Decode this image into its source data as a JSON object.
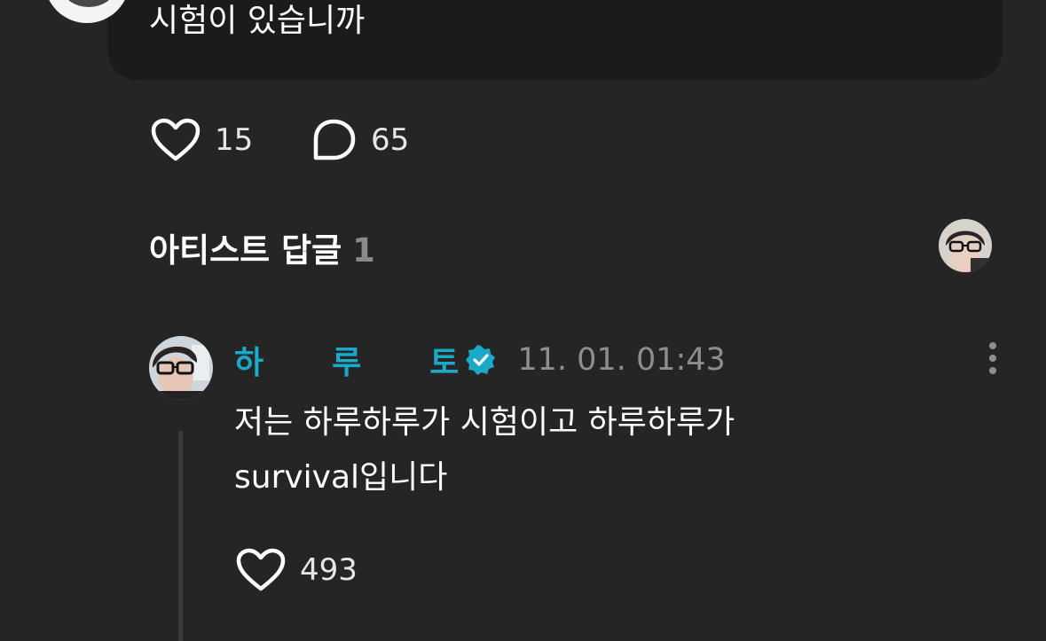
{
  "post": {
    "text": "시험이 있습니까",
    "like_count": "15",
    "comment_count": "65"
  },
  "artist_replies": {
    "title": "아티스트 답글",
    "count": "1"
  },
  "reply": {
    "author_chars": [
      "하",
      "루",
      "토"
    ],
    "timestamp": "11. 01. 01:43",
    "text": "저는 하루하루가 시험이고 하루하루가\nsurvival입니다",
    "like_count": "493"
  },
  "colors": {
    "background": "#252525",
    "bubble": "#1b1b1b",
    "author_accent": "#1aa9c8",
    "muted_text": "#8e8e8e"
  },
  "icons": {
    "like": "heart-outline-icon",
    "comment": "speech-bubble-icon",
    "verified": "verified-badge-icon",
    "more": "more-vertical-icon"
  }
}
